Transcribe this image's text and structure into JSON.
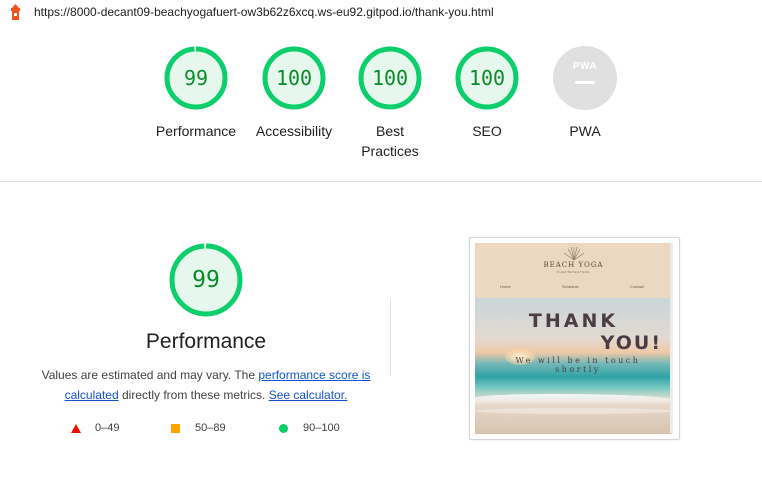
{
  "url": "https://8000-decant09-beachyogafuert-ow3b62z6xcq.ws-eu92.gitpod.io/thank-you.html",
  "gauges": [
    {
      "score": "99",
      "label": "Performance",
      "value": 99
    },
    {
      "score": "100",
      "label": "Accessibility",
      "value": 100
    },
    {
      "score": "100",
      "label": "Best Practices",
      "value": 100
    },
    {
      "score": "100",
      "label": "SEO",
      "value": 100
    },
    {
      "score": "PWA",
      "label": "PWA"
    }
  ],
  "performance": {
    "score": "99",
    "value": 99,
    "title": "Performance",
    "desc_prefix": "Values are estimated and may vary. The ",
    "link1": "performance score is calculated",
    "desc_mid": " directly from these metrics. ",
    "link2": "See calculator."
  },
  "legend": {
    "fail": "0–49",
    "average": "50–89",
    "pass": "90–100"
  },
  "colors": {
    "pass": "#0cce6b",
    "average": "#ffa400",
    "fail": "#eb0f00",
    "pass_text": "#0c8b2a",
    "link": "#1155cc"
  },
  "thumbnail": {
    "brand": "BEACH YOGA",
    "sub": "FUERTEVENTURA",
    "nav": [
      "Home",
      "Schedule",
      "Contact"
    ],
    "line1": "THANK",
    "line2": "YOU!",
    "line3": "We will be in touch shortly"
  }
}
